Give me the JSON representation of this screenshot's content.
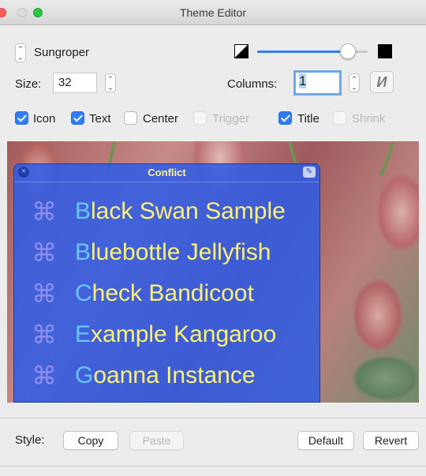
{
  "window": {
    "title": "Theme Editor"
  },
  "theme": {
    "name": "Sungroper"
  },
  "size": {
    "label": "Size:",
    "value": "32"
  },
  "columns": {
    "label": "Columns:",
    "value": "1"
  },
  "contrast_slider": {
    "level": 0.82
  },
  "checkboxes": [
    {
      "label": "Icon",
      "checked": true,
      "enabled": true
    },
    {
      "label": "Text",
      "checked": true,
      "enabled": true
    },
    {
      "label": "Center",
      "checked": false,
      "enabled": true
    },
    {
      "label": "Trigger",
      "checked": false,
      "enabled": false
    },
    {
      "label": "Title",
      "checked": true,
      "enabled": true
    },
    {
      "label": "Shrink",
      "checked": false,
      "enabled": false
    }
  ],
  "panel": {
    "title": "Conflict",
    "items": [
      {
        "initial": "B",
        "rest": "lack Swan Sample"
      },
      {
        "initial": "B",
        "rest": "luebottle Jellyfish"
      },
      {
        "initial": "C",
        "rest": "heck Bandicoot"
      },
      {
        "initial": "E",
        "rest": "xample Kangaroo"
      },
      {
        "initial": "G",
        "rest": "oanna Instance"
      }
    ],
    "item_icon": "⌘"
  },
  "bottom": {
    "style_label": "Style:",
    "copy": "Copy",
    "paste": "Paste",
    "default": "Default",
    "revert": "Revert"
  },
  "colors": {
    "accent": "#2f7cf6",
    "panel_bg": "#2d5ce8",
    "item_initial": "#66c6ff",
    "item_text": "#fff270",
    "panel_title": "#fff48a"
  },
  "icons": [
    "close-icon",
    "edit-icon",
    "command-icon",
    "contrast-icon",
    "black-square-icon",
    "rotate-icon",
    "stepper-icon"
  ]
}
